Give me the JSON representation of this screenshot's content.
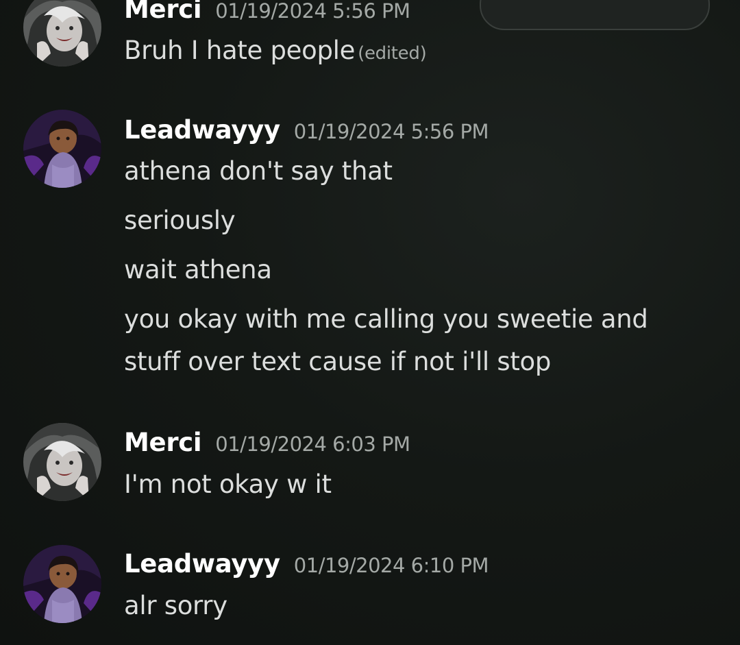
{
  "messages": [
    {
      "username": "Merci",
      "timestamp": "01/19/2024 5:56 PM",
      "lines": [
        "Bruh I hate people"
      ],
      "edited_label": "(edited)"
    },
    {
      "username": "Leadwayyy",
      "timestamp": "01/19/2024 5:56 PM",
      "lines": [
        "athena don't say that",
        "seriously",
        "wait athena",
        "you okay with me calling you sweetie and",
        "stuff over text cause if not i'll stop"
      ]
    },
    {
      "username": "Merci",
      "timestamp": "01/19/2024 6:03 PM",
      "lines": [
        "I'm not okay w it"
      ]
    },
    {
      "username": "Leadwayyy",
      "timestamp": "01/19/2024 6:10 PM",
      "lines": [
        "alr sorry"
      ]
    }
  ],
  "avatars": {
    "merci": "avatar-merci",
    "leadwayyy": "avatar-leadwayyy"
  }
}
